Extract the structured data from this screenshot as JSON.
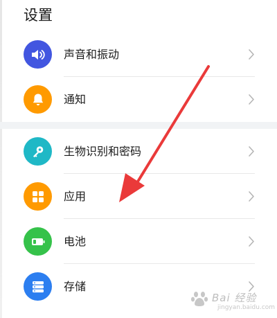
{
  "header": {
    "title": "设置"
  },
  "colors": {
    "sound": "#4256e0",
    "notify": "#ff9a00",
    "biometric": "#1fb8c6",
    "apps": "#ff9a00",
    "battery": "#35c24a",
    "storage": "#2c7ef0",
    "arrow": "#ea3a3a"
  },
  "groups": [
    {
      "items": [
        {
          "label": "声音和振动",
          "icon": "speaker-icon"
        },
        {
          "label": "通知",
          "icon": "bell-icon"
        }
      ]
    },
    {
      "items": [
        {
          "label": "生物识别和密码",
          "icon": "key-icon"
        },
        {
          "label": "应用",
          "icon": "apps-grid-icon"
        },
        {
          "label": "电池",
          "icon": "battery-icon"
        },
        {
          "label": "存储",
          "icon": "storage-icon"
        }
      ]
    }
  ],
  "watermark": {
    "text": "Bai 经验",
    "sub": "jingyan.baidu.com"
  }
}
